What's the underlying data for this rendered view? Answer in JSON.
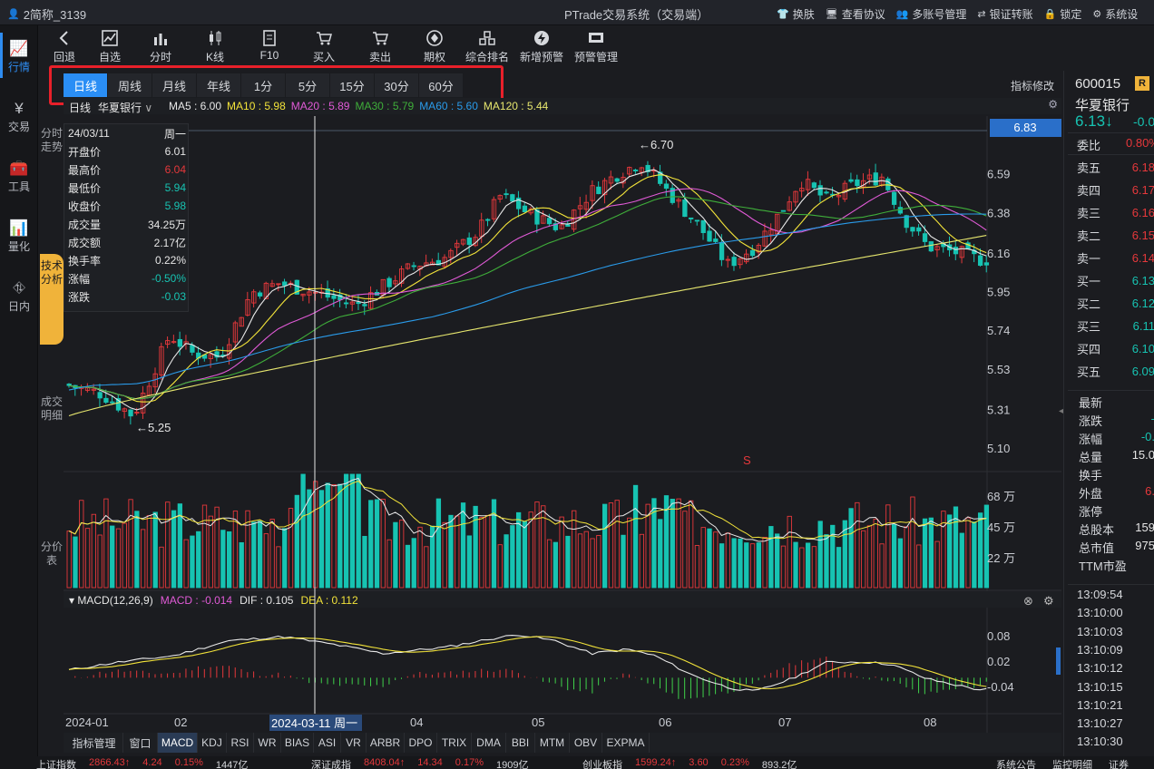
{
  "titlebar": {
    "account": "2简称_3139",
    "app_title": "PTrade交易系统（交易端）",
    "links": [
      {
        "label": "换肤",
        "icon": "shirt-icon"
      },
      {
        "label": "查看协议",
        "icon": "monitor-icon"
      },
      {
        "label": "多账号管理",
        "icon": "users-icon"
      },
      {
        "label": "银证转账",
        "icon": "transfer-icon"
      },
      {
        "label": "锁定",
        "icon": "lock-icon"
      },
      {
        "label": "系统设",
        "icon": "gear-icon"
      }
    ]
  },
  "leftnav": [
    {
      "label": "行情",
      "icon": "chart-icon",
      "active": true
    },
    {
      "label": "交易",
      "icon": "yen-icon",
      "active": false
    },
    {
      "label": "工具",
      "icon": "toolbox-icon",
      "active": false
    },
    {
      "label": "量化",
      "icon": "quant-icon",
      "active": false
    },
    {
      "label": "日内",
      "icon": "intraday-icon",
      "active": false
    }
  ],
  "toolbar": [
    {
      "label": "回退",
      "icon": "back-icon"
    },
    {
      "label": "自选",
      "icon": "watchlist-icon"
    },
    {
      "label": "分时",
      "icon": "timeshare-icon"
    },
    {
      "label": "K线",
      "icon": "candle-icon"
    },
    {
      "label": "F10",
      "icon": "document-icon"
    },
    {
      "label": "买入",
      "icon": "cart-in-icon"
    },
    {
      "label": "卖出",
      "icon": "cart-out-icon"
    },
    {
      "label": "期权",
      "icon": "option-icon"
    },
    {
      "label": "综合排名",
      "icon": "ranking-icon"
    },
    {
      "label": "新增预警",
      "icon": "alert-add-icon"
    },
    {
      "label": "预警管理",
      "icon": "alert-manage-icon"
    }
  ],
  "sidetabs": [
    {
      "label": "分时走势",
      "active": false
    },
    {
      "label": "技术分析",
      "active": true
    },
    {
      "label": "成交明细",
      "active": false
    },
    {
      "label": "分价表",
      "active": false
    }
  ],
  "periods": [
    {
      "label": "日线",
      "active": true
    },
    {
      "label": "周线"
    },
    {
      "label": "月线"
    },
    {
      "label": "年线"
    },
    {
      "label": "1分"
    },
    {
      "label": "5分"
    },
    {
      "label": "15分"
    },
    {
      "label": "30分"
    },
    {
      "label": "60分"
    }
  ],
  "indicator_edit": "指标修改",
  "ma_bar": {
    "period": "日线",
    "stock": "华夏银行",
    "items": [
      {
        "label": "MA5 : 6.00",
        "color": "#e8e8e8"
      },
      {
        "label": "MA10 : 5.98",
        "color": "#f2e33a"
      },
      {
        "label": "MA20 : 5.89",
        "color": "#e05ad6"
      },
      {
        "label": "MA30 : 5.79",
        "color": "#3fae3a"
      },
      {
        "label": "MA60 : 5.60",
        "color": "#2a9bea"
      },
      {
        "label": "MA120 : 5.44",
        "color": "#e6e66e"
      }
    ]
  },
  "infobox": {
    "date": "24/03/11",
    "weekday": "周一",
    "rows": [
      {
        "label": "开盘价",
        "value": "6.01",
        "color": "#e6e6e6"
      },
      {
        "label": "最高价",
        "value": "6.04",
        "color": "#e5383b"
      },
      {
        "label": "最低价",
        "value": "5.94",
        "color": "#17c3b2"
      },
      {
        "label": "收盘价",
        "value": "5.98",
        "color": "#17c3b2"
      },
      {
        "label": "成交量",
        "value": "34.25万",
        "color": "#e6e6e6"
      },
      {
        "label": "成交额",
        "value": "2.17亿",
        "color": "#e6e6e6"
      },
      {
        "label": "换手率",
        "value": "0.22%",
        "color": "#e6e6e6"
      },
      {
        "label": "涨幅",
        "value": "-0.50%",
        "color": "#17c3b2"
      },
      {
        "label": "涨跌",
        "value": "-0.03",
        "color": "#17c3b2"
      }
    ]
  },
  "price_axis": {
    "current": "6.83",
    "ticks": [
      "6.59",
      "6.38",
      "6.16",
      "5.95",
      "5.74",
      "5.53",
      "5.31",
      "5.10"
    ]
  },
  "annotations": {
    "high": "←6.70",
    "low": "←5.25",
    "signal": "S"
  },
  "volume_axis": {
    "ticks": [
      "68 万",
      "45 万",
      "22 万"
    ]
  },
  "macd": {
    "label": "MACD(12,26,9)",
    "macd": "MACD : -0.014",
    "dif": "DIF : 0.105",
    "dea": "DEA : 0.112",
    "ticks": [
      "0.08",
      "0.02",
      "-0.04"
    ]
  },
  "time_axis": {
    "labels": [
      "2024-01",
      "02",
      "04",
      "05",
      "06",
      "07",
      "08"
    ],
    "cursor": "2024-03-11 周一"
  },
  "bottom_tabs": [
    {
      "label": "指标管理"
    },
    {
      "label": "窗口"
    },
    {
      "label": "MACD",
      "active": true
    },
    {
      "label": "KDJ"
    },
    {
      "label": "RSI"
    },
    {
      "label": "WR"
    },
    {
      "label": "BIAS"
    },
    {
      "label": "ASI"
    },
    {
      "label": "VR"
    },
    {
      "label": "ARBR"
    },
    {
      "label": "DPO"
    },
    {
      "label": "TRIX"
    },
    {
      "label": "DMA"
    },
    {
      "label": "BBI"
    },
    {
      "label": "MTM"
    },
    {
      "label": "OBV"
    },
    {
      "label": "EXPMA"
    }
  ],
  "quote": {
    "code": "600015",
    "badge": "R",
    "name": "华夏银行",
    "price": "6.13↓",
    "change": "-0.0",
    "weibi_label": "委比",
    "weibi": "0.80%"
  },
  "orderbook": [
    {
      "label": "卖五",
      "price": "6.18",
      "color": "#e5383b"
    },
    {
      "label": "卖四",
      "price": "6.17",
      "color": "#e5383b"
    },
    {
      "label": "卖三",
      "price": "6.16",
      "color": "#e5383b"
    },
    {
      "label": "卖二",
      "price": "6.15",
      "color": "#e5383b"
    },
    {
      "label": "卖一",
      "price": "6.14",
      "color": "#e5383b"
    },
    {
      "label": "买一",
      "price": "6.13",
      "color": "#17c3b2"
    },
    {
      "label": "买二",
      "price": "6.12",
      "color": "#17c3b2"
    },
    {
      "label": "买三",
      "price": "6.11",
      "color": "#17c3b2"
    },
    {
      "label": "买四",
      "price": "6.10",
      "color": "#17c3b2"
    },
    {
      "label": "买五",
      "price": "6.09",
      "color": "#17c3b2"
    }
  ],
  "stats": [
    {
      "label": "最新",
      "value": ""
    },
    {
      "label": "涨跌",
      "value": "-",
      "color": "#17c3b2"
    },
    {
      "label": "涨幅",
      "value": "-0.",
      "color": "#17c3b2"
    },
    {
      "label": "总量",
      "value": "15.0",
      "color": "#e6e6e6"
    },
    {
      "label": "换手",
      "value": ""
    },
    {
      "label": "外盘",
      "value": "6.",
      "color": "#e5383b"
    },
    {
      "label": "涨停",
      "value": ""
    },
    {
      "label": "总股本",
      "value": "159",
      "color": "#e6e6e6"
    },
    {
      "label": "总市值",
      "value": "975",
      "color": "#e6e6e6"
    },
    {
      "label": "TTM市盈",
      "value": ""
    }
  ],
  "ticks_times": [
    "13:09:54",
    "13:10:00",
    "13:10:03",
    "13:10:09",
    "13:10:12",
    "13:10:15",
    "13:10:21",
    "13:10:27",
    "13:10:30"
  ],
  "statusbar": [
    {
      "name": "上证指数",
      "v1": "2866.43↑",
      "v2": "4.24",
      "v3": "0.15%",
      "v4": "1447亿"
    },
    {
      "name": "深证成指",
      "v1": "8408.04↑",
      "v2": "14.34",
      "v3": "0.17%",
      "v4": "1909亿"
    },
    {
      "name": "创业板指",
      "v1": "1599.24↑",
      "v2": "3.60",
      "v3": "0.23%",
      "v4": "893.2亿"
    }
  ],
  "status_right": [
    "系统公告",
    "监控明细",
    "证券"
  ]
}
